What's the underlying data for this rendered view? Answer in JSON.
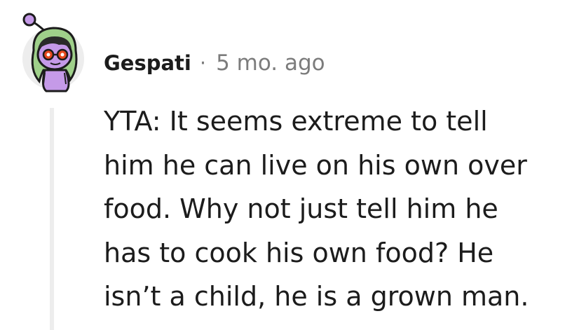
{
  "comment": {
    "author": "Gespati",
    "separator": "·",
    "timestamp": "5 mo. ago",
    "avatar": {
      "icon": "snoo-avatar-icon",
      "colors": {
        "hood": "#9fd08a",
        "face": "#c59ae8",
        "glasses": "#e8481c",
        "antenna": "#c59ae8",
        "outline": "#1c1c1c",
        "hair": "#2a2a2a",
        "background": "#ededed"
      }
    },
    "body_lines": [
      "YTA: It seems extreme to tell",
      "him he can live on his own over",
      "food. Why not just tell him he",
      "has to cook his own food? He",
      "isn’t a child, he is a grown man."
    ]
  }
}
